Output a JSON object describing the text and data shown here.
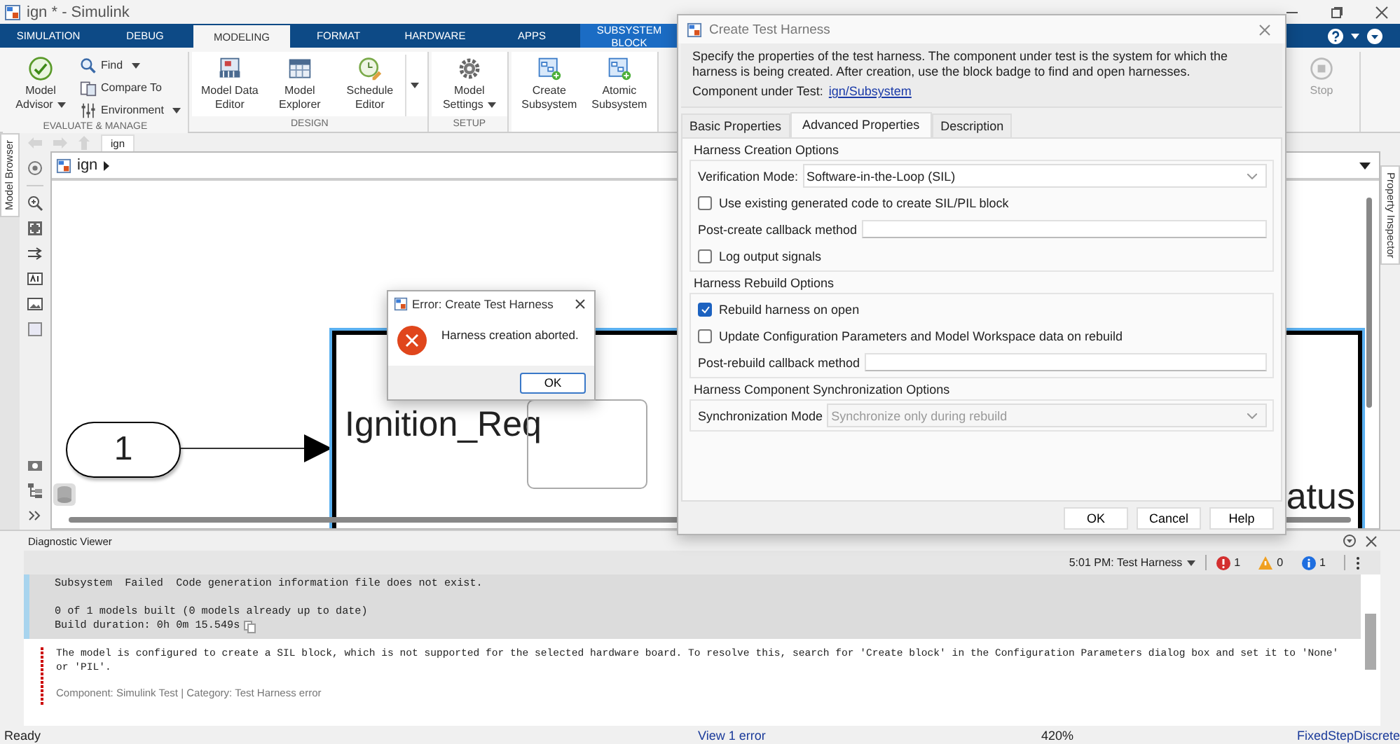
{
  "window": {
    "title": "ign * - Simulink"
  },
  "tabs": [
    {
      "label": "SIMULATION",
      "selected": false,
      "kind": "standard"
    },
    {
      "label": "DEBUG",
      "selected": false,
      "kind": "standard"
    },
    {
      "label": "MODELING",
      "selected": true,
      "kind": "standard"
    },
    {
      "label": "FORMAT",
      "selected": false,
      "kind": "standard"
    },
    {
      "label": "HARDWARE",
      "selected": false,
      "kind": "standard"
    },
    {
      "label": "APPS",
      "selected": false,
      "kind": "standard"
    },
    {
      "label": "SUBSYSTEM BLOCK",
      "selected": false,
      "kind": "contextual"
    }
  ],
  "toolstrip": [
    {
      "title": "EVALUATE & MANAGE",
      "buttons": [
        {
          "kind": "large",
          "label": "Model Advisor",
          "dropdown": true
        },
        {
          "kind": "small",
          "label": "Find",
          "dropdown": true
        },
        {
          "kind": "small",
          "label": "Compare To",
          "dropdown": false
        },
        {
          "kind": "small",
          "label": "Environment",
          "dropdown": true
        }
      ]
    },
    {
      "title": "DESIGN",
      "buttons": [
        {
          "kind": "large",
          "label": "Model Data Editor",
          "dropdown": false
        },
        {
          "kind": "large",
          "label": "Model Explorer",
          "dropdown": false
        },
        {
          "kind": "large",
          "label": "Schedule Editor",
          "dropdown": false
        },
        {
          "kind": "expander"
        }
      ]
    },
    {
      "title": "SETUP",
      "buttons": [
        {
          "kind": "large",
          "label": "Model Settings",
          "dropdown": true
        }
      ]
    },
    {
      "buttons": [
        {
          "kind": "large",
          "label": "Create Subsystem",
          "dropdown": false
        },
        {
          "kind": "large",
          "label": "Atomic Subsystem",
          "dropdown": false
        }
      ]
    }
  ],
  "stop_button": {
    "label": "Stop",
    "disabled": true
  },
  "side_tabs": {
    "left": "Model Browser",
    "right": "Property Inspector"
  },
  "explorer_tab": "ign",
  "breadcrumb": "ign",
  "canvas": {
    "inport": "1",
    "block_label": "Ignition_Req",
    "output_label": "atus"
  },
  "harness_dialog": {
    "title": "Create Test Harness",
    "description": "Specify the properties of the test harness. The component under test is the system for which the harness is being created. After creation, use the block badge to find and open harnesses.",
    "component_label": "Component under Test:",
    "component_link": "ign/Subsystem",
    "tabs": [
      {
        "label": "Basic Properties",
        "selected": false
      },
      {
        "label": "Advanced Properties",
        "selected": true
      },
      {
        "label": "Description",
        "selected": false
      }
    ],
    "groups": [
      {
        "title": "Harness Creation Options",
        "rows": [
          {
            "kind": "select",
            "label": "Verification Mode:",
            "value": "Software-in-the-Loop (SIL)",
            "disabled": false
          },
          {
            "kind": "checkbox",
            "label": "Use existing generated code to create SIL/PIL block",
            "checked": false
          },
          {
            "kind": "textfield",
            "label": "Post-create callback method"
          },
          {
            "kind": "checkbox",
            "label": "Log output signals",
            "checked": false
          }
        ]
      },
      {
        "title": "Harness Rebuild Options",
        "rows": [
          {
            "kind": "checkbox",
            "label": "Rebuild harness on open",
            "checked": true
          },
          {
            "kind": "checkbox",
            "label": "Update Configuration Parameters and Model Workspace data on rebuild",
            "checked": false
          },
          {
            "kind": "textfield",
            "label": "Post-rebuild callback method"
          }
        ]
      },
      {
        "title": "Harness Component Synchronization Options",
        "rows": [
          {
            "kind": "select",
            "label": "Synchronization Mode",
            "value": "Synchronize only during rebuild",
            "disabled": true
          }
        ]
      }
    ],
    "buttons": [
      "OK",
      "Cancel",
      "Help"
    ]
  },
  "error_dialog": {
    "title": "Error: Create Test Harness",
    "message": "Harness creation aborted.",
    "button": "OK"
  },
  "diagnostics": {
    "title": "Diagnostic Viewer",
    "run": "5:01 PM: Test Harness",
    "counts": [
      {
        "kind": "error",
        "count": "1"
      },
      {
        "kind": "warning",
        "count": "0"
      },
      {
        "kind": "info",
        "count": "1"
      }
    ],
    "log": [
      [
        "Subsystem  Failed  Code generation information file does not exist."
      ],
      [
        "0 of 1 models built (0 models already up to date)",
        "Build duration: 0h 0m 15.549s"
      ]
    ],
    "message": "The model is configured to create a SIL block, which is not supported for the selected hardware board. To resolve this, search for 'Create block' in the Configuration Parameters dialog box and set it to 'None' or 'PIL'.",
    "source": "Component:  Simulink Test | Category:  Test Harness error"
  },
  "status_bar": {
    "state": "Ready",
    "link": "View 1 error",
    "zoom": "420%",
    "solver": "FixedStepDiscrete"
  }
}
